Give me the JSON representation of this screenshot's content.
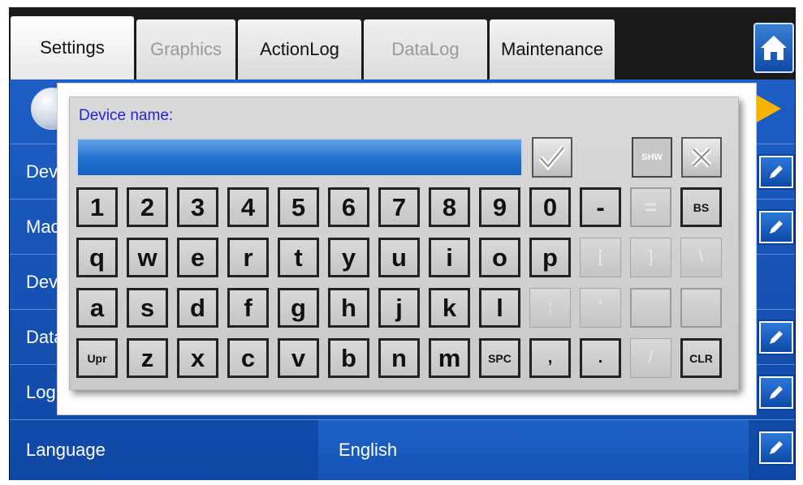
{
  "tabs": [
    {
      "label": "Settings",
      "state": "active"
    },
    {
      "label": "Graphics",
      "state": "disabled"
    },
    {
      "label": "ActionLog",
      "state": "normal"
    },
    {
      "label": "DataLog",
      "state": "disabled"
    },
    {
      "label": "Maintenance",
      "state": "normal"
    }
  ],
  "rows": [
    {
      "label": "Dev"
    },
    {
      "label": "Mac"
    },
    {
      "label": "Dev"
    },
    {
      "label": "Data"
    },
    {
      "label": "Log"
    },
    {
      "label": "Language",
      "value": "English"
    }
  ],
  "dialog": {
    "title": "Device name:",
    "input_value": "",
    "shw_label": "SHW",
    "keys_row1": [
      "1",
      "2",
      "3",
      "4",
      "5",
      "6",
      "7",
      "8",
      "9",
      "0",
      "-",
      "=",
      "BS"
    ],
    "keys_row2": [
      "q",
      "w",
      "e",
      "r",
      "t",
      "y",
      "u",
      "i",
      "o",
      "p",
      "[",
      "]",
      "\\"
    ],
    "keys_row3": [
      "a",
      "s",
      "d",
      "f",
      "g",
      "h",
      "j",
      "k",
      "l",
      ";",
      "'",
      "",
      ""
    ],
    "keys_row4": [
      "Upr",
      "z",
      "x",
      "c",
      "v",
      "b",
      "n",
      "m",
      "SPC",
      ",",
      ".",
      "/",
      "CLR"
    ]
  },
  "colors": {
    "panel_blue": "#1a56bd",
    "dialog_title": "#2223d9",
    "arrow": "#f5b400"
  },
  "icons": [
    "home-icon",
    "globe-icon",
    "play-arrow-icon",
    "edit-pencil-icon",
    "checkmark-icon",
    "close-x-icon"
  ]
}
